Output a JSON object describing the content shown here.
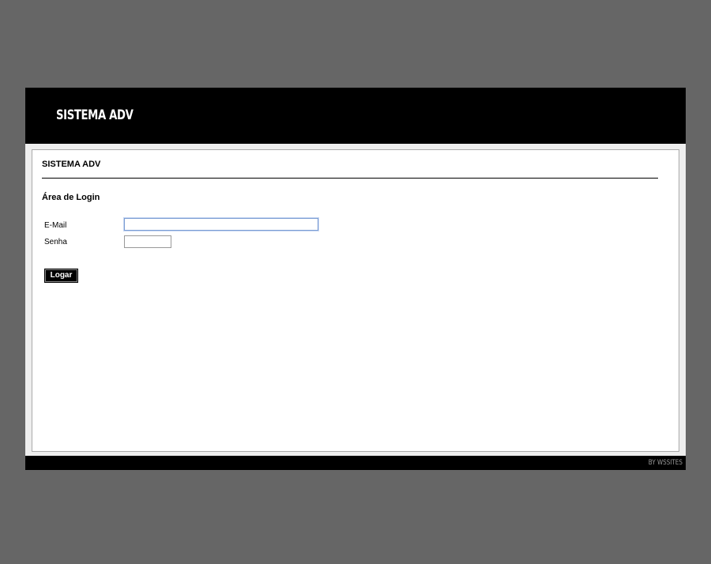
{
  "header": {
    "logo_text": "SISTEMA ADV"
  },
  "content": {
    "section_title": "SISTEMA ADV",
    "login_heading": "Área de Login"
  },
  "form": {
    "email_label": "E-Mail",
    "email_value": "",
    "senha_label": "Senha",
    "senha_value": "",
    "submit_label": "Logar"
  },
  "footer": {
    "credit": "BY WSSITES"
  },
  "colors": {
    "page_background": "#666666",
    "frame": "#000000",
    "panel": "#ffffff",
    "focus_border": "#7a9cd3"
  }
}
